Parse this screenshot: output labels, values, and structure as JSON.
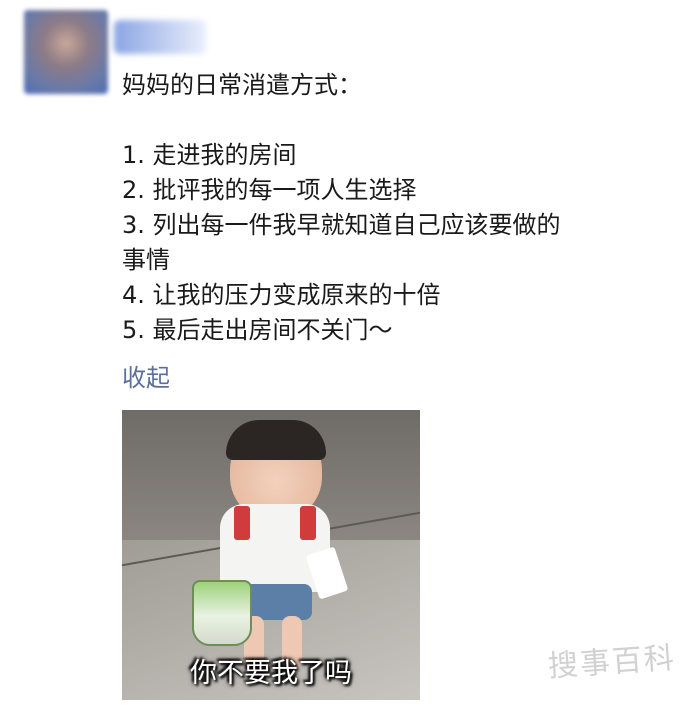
{
  "post": {
    "heading": "妈妈的日常消遣方式：",
    "items": [
      "1. 走进我的房间",
      "2. 批评我的每一项人生选择",
      "3. 列出每一件我早就知道自己应该要做的",
      "事情",
      "4. 让我的压力变成原来的十倍",
      "5. 最后走出房间不关门～"
    ],
    "collapse_label": "收起"
  },
  "image": {
    "caption": "你不要我了吗"
  },
  "watermark": {
    "text": "搜事百科"
  },
  "colors": {
    "text": "#1a1a1a",
    "link": "#5a6f99",
    "background": "#ffffff"
  }
}
